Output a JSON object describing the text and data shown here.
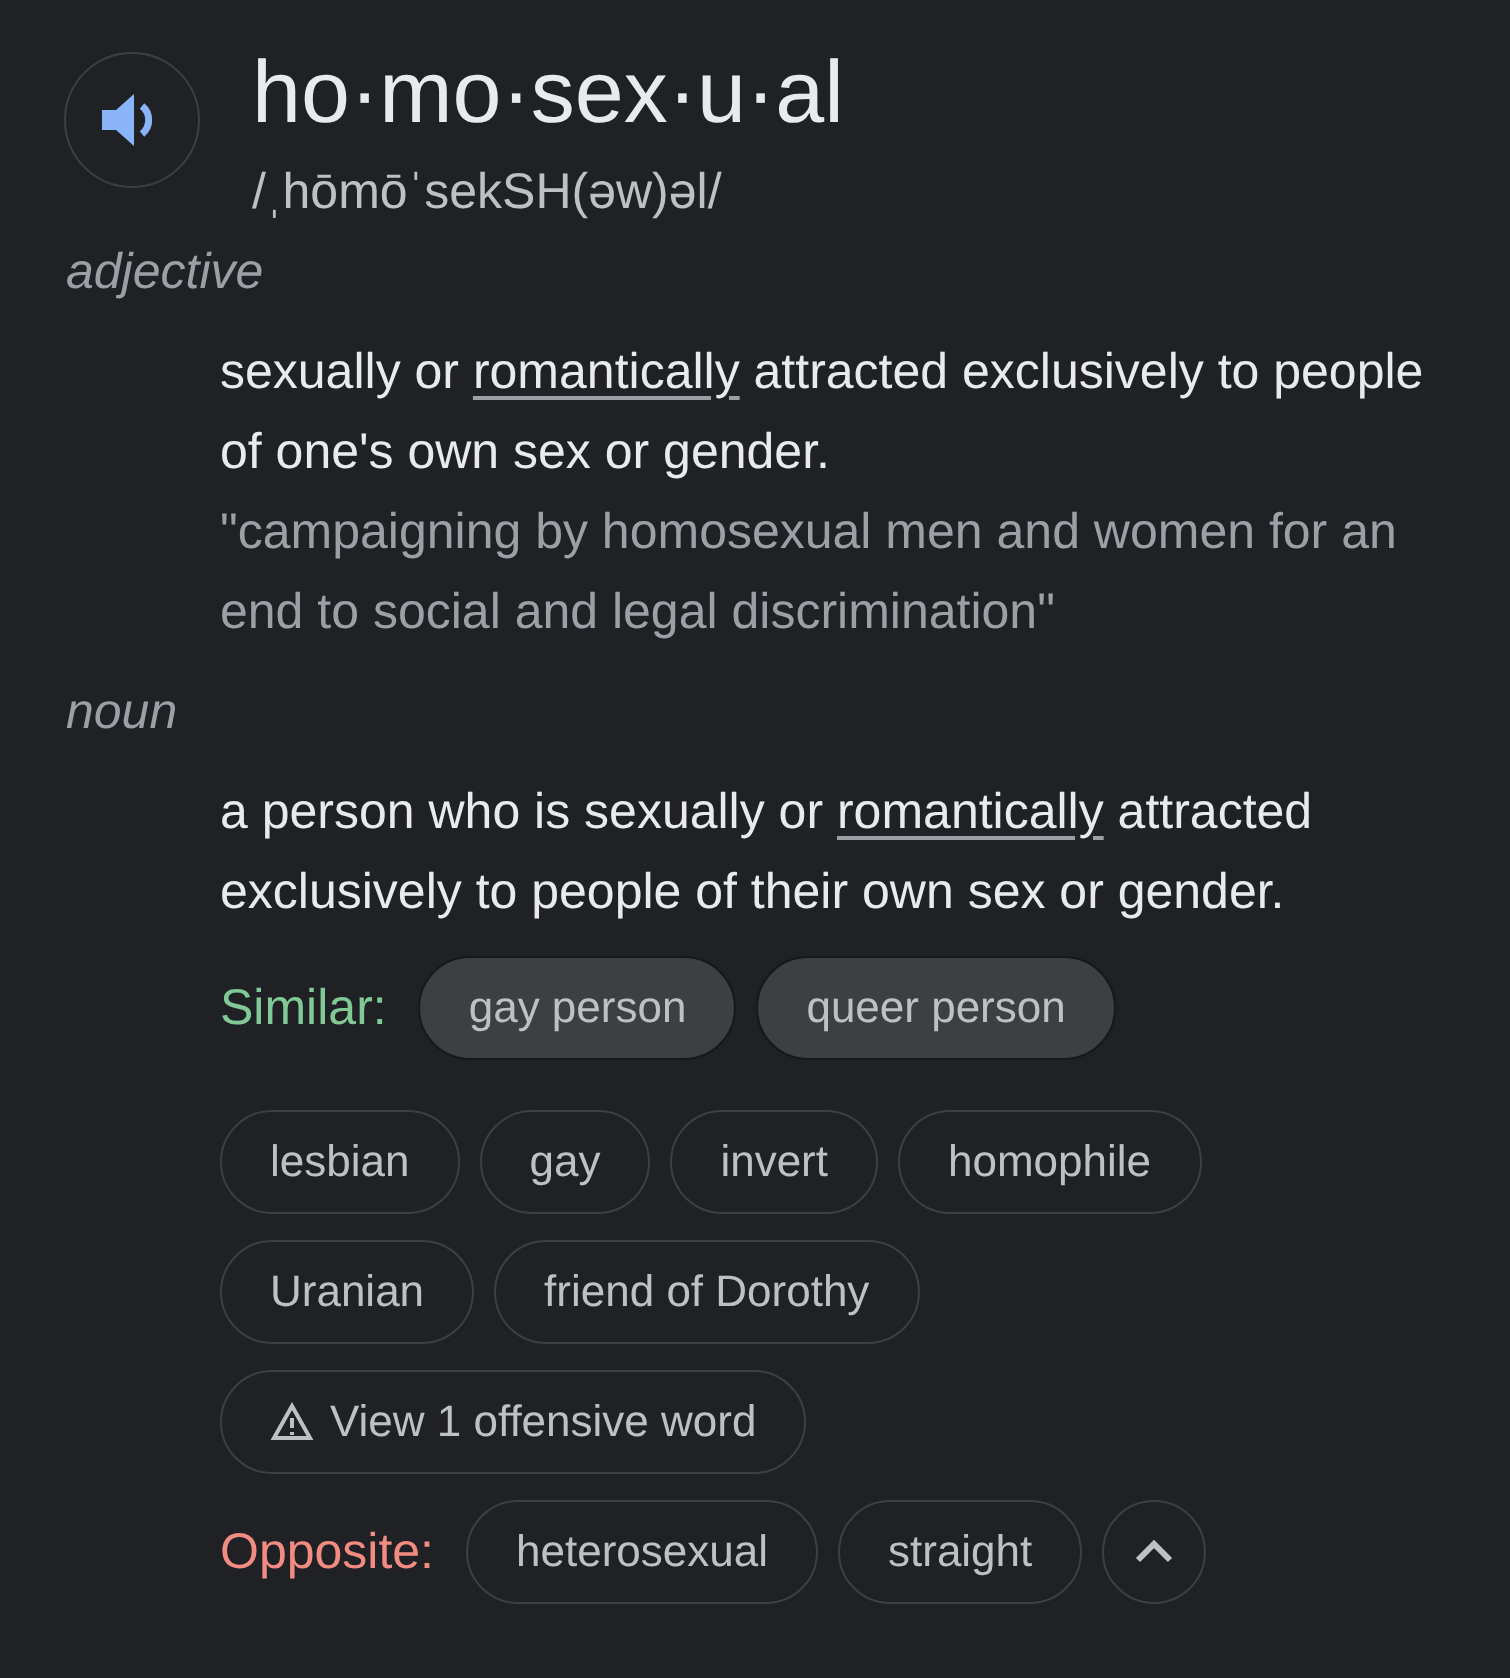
{
  "headword": "ho·mo·sex·u·al",
  "pronunciation": "/ˌhōmōˈsekSH(əw)əl/",
  "senses": [
    {
      "part_of_speech": "adjective",
      "definition": {
        "before": "sexually or ",
        "link": "romantically",
        "after": " attracted exclusively to people of one's own sex or gender."
      },
      "example": "\"campaigning by homosexual men and women for an end to social and legal discrimination\""
    },
    {
      "part_of_speech": "noun",
      "definition": {
        "before": "a person who is sexually or ",
        "link": "romantically",
        "after": " attracted exclusively to people of their own sex or gender."
      },
      "similar": {
        "label": "Similar:",
        "primary": [
          "gay person",
          "queer person"
        ],
        "more_rows": [
          [
            "lesbian",
            "gay",
            "invert",
            "homophile"
          ],
          [
            "Uranian",
            "friend of Dorothy"
          ]
        ],
        "offensive_button": "View 1 offensive word"
      },
      "opposite": {
        "label": "Opposite:",
        "words": [
          "heterosexual",
          "straight"
        ],
        "expanded": true
      }
    }
  ]
}
